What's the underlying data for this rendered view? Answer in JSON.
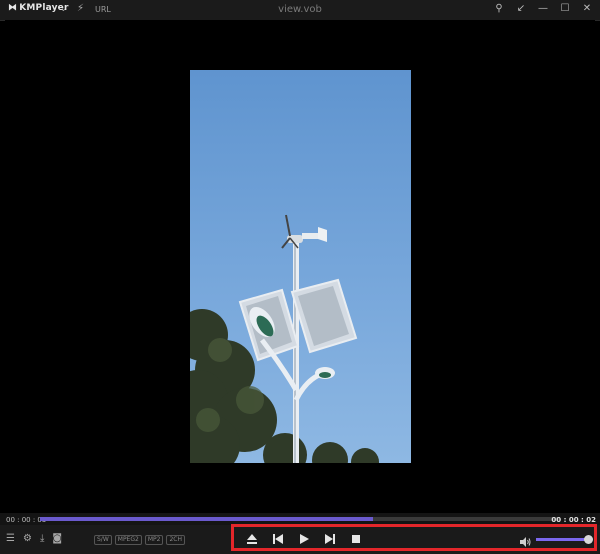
{
  "app": {
    "logo_text": "KMPlayer",
    "logo_menu_glyph": "⌄",
    "url_label": "URL",
    "window_title": "view.vob"
  },
  "window_controls": [
    {
      "name": "pin-icon",
      "glyph": "⚲"
    },
    {
      "name": "restore-arrow-icon",
      "glyph": "↙"
    },
    {
      "name": "minimize-icon",
      "glyph": "—"
    },
    {
      "name": "maximize-icon",
      "glyph": "☐"
    },
    {
      "name": "close-icon",
      "glyph": "✕"
    }
  ],
  "playback": {
    "time_current": "00 : 00 : 03",
    "time_total": "00 : 00 : 02",
    "progress": 0.64,
    "volume": 1.0
  },
  "left_controls": [
    {
      "name": "playlist-menu-icon",
      "glyph": "☰"
    },
    {
      "name": "settings-gear-icon",
      "glyph": "⚙"
    },
    {
      "name": "capture-icon",
      "glyph": "⤓"
    },
    {
      "name": "vr-glasses-icon",
      "glyph": "◙"
    }
  ],
  "badges": [
    "S/W",
    "MPEG2",
    "MP2",
    "2CH"
  ],
  "transport": {
    "eject": "eject-icon",
    "previous": "previous-icon",
    "play": "play-icon",
    "next": "next-icon",
    "stop": "stop-icon"
  },
  "colors": {
    "highlight": "#e3262a",
    "progress": "#6a5acd",
    "volume": "#7b68ee"
  }
}
